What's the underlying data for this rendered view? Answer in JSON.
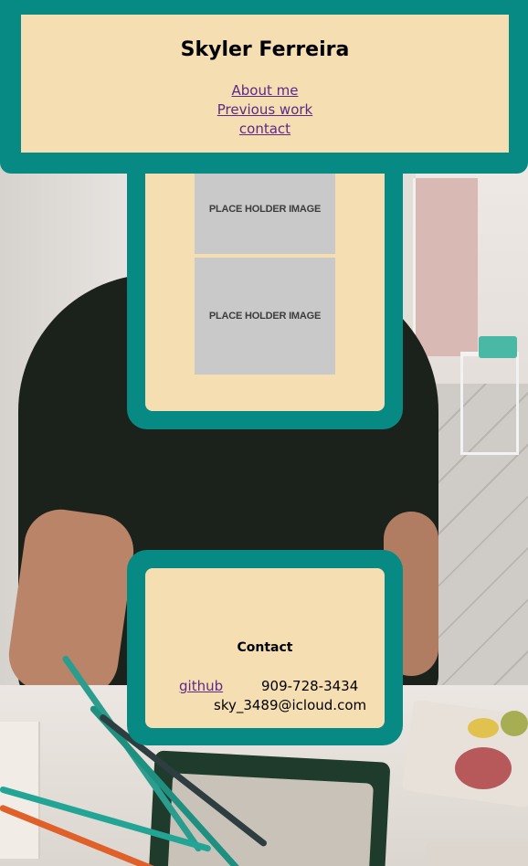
{
  "header": {
    "title": "Skyler Ferreira",
    "nav": [
      {
        "label": "About me"
      },
      {
        "label": "Previous work"
      },
      {
        "label": "contact"
      }
    ]
  },
  "work": {
    "images": [
      {
        "label": "PLACE HOLDER IMAGE"
      },
      {
        "label": "PLACE HOLDER IMAGE"
      }
    ]
  },
  "contact": {
    "title": "Contact",
    "github_label": "github",
    "phone": "909-728-3434",
    "email": "sky_3489@icloud.com"
  },
  "colors": {
    "card_frame": "#088a84",
    "card_fill": "#f6deb3",
    "link": "#5c2a86",
    "placeholder": "#c9c9c9"
  }
}
